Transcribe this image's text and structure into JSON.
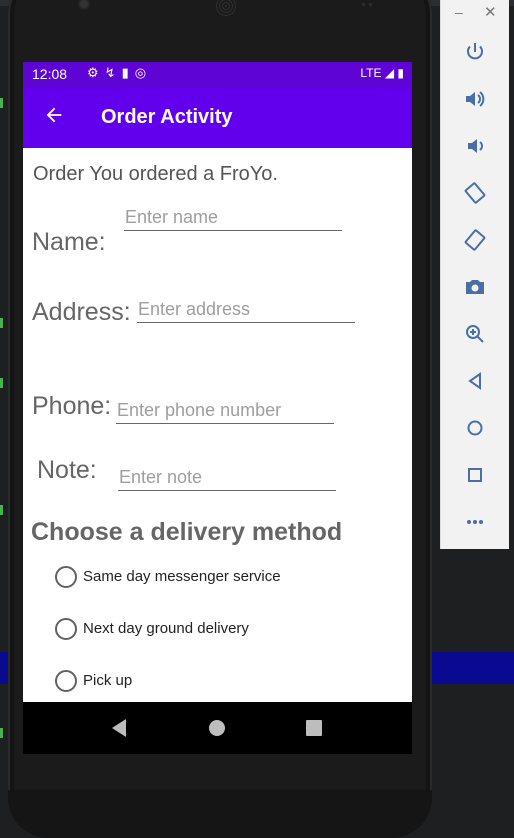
{
  "status_bar": {
    "time": "12:08",
    "network": "LTE"
  },
  "app_bar": {
    "title": "Order Activity"
  },
  "order_message": "Order You ordered a FroYo.",
  "form": {
    "name_label": "Name:",
    "name_placeholder": "Enter name",
    "address_label": "Address:",
    "address_placeholder": "Enter address",
    "phone_label": "Phone:",
    "phone_placeholder": "Enter phone number",
    "note_label": "Note:",
    "note_placeholder": "Enter note"
  },
  "delivery": {
    "title": "Choose a delivery method",
    "options": [
      "Same day messenger service",
      "Next day ground delivery",
      "Pick up"
    ]
  },
  "colors": {
    "status_bar": "#5e05d6",
    "app_bar": "#6200ee"
  },
  "toolbar_icons": [
    "power-icon",
    "volume-up-icon",
    "volume-down-icon",
    "rotate-left-icon",
    "rotate-right-icon",
    "camera-icon",
    "zoom-icon",
    "back-icon",
    "home-icon",
    "overview-icon",
    "more-icon"
  ]
}
